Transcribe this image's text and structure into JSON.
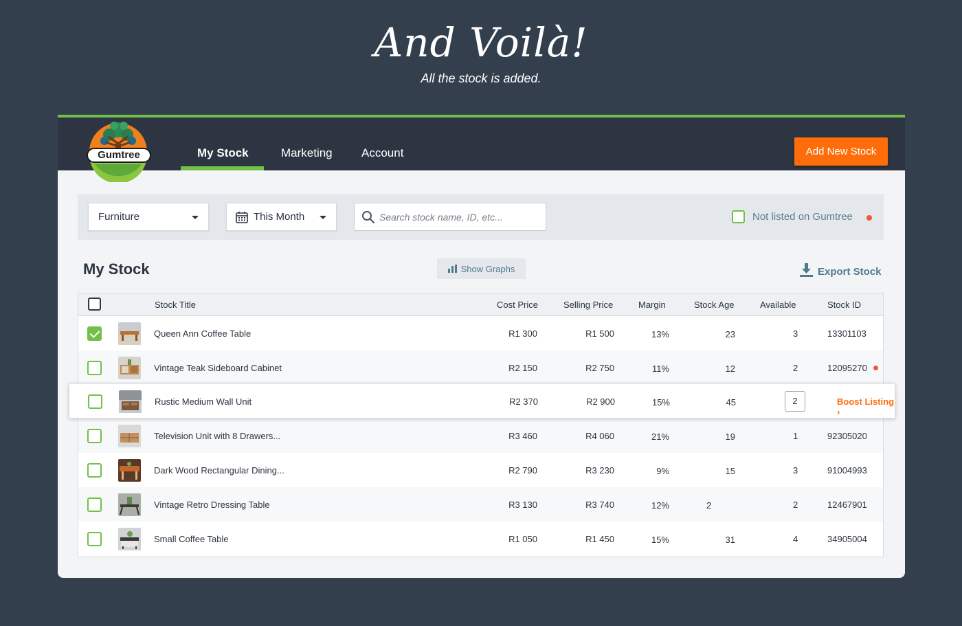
{
  "hero": {
    "title": "And Voilà!",
    "subtitle": "All the stock is added."
  },
  "brand": {
    "logo_text": "Gumtree",
    "accent": "#72c04a",
    "cta_color": "#ff6d0a",
    "header_bg": "#2c3541"
  },
  "nav": {
    "items": [
      "My Stock",
      "Marketing",
      "Account"
    ],
    "active": "My Stock"
  },
  "toolbar": {
    "add_label": "Add New Stock"
  },
  "filters": {
    "category": "Furniture",
    "date_range": "This Month",
    "search_placeholder": "Search stock name, ID, etc...",
    "not_listed_label": "Not listed on Gumtree",
    "not_listed_checked": false
  },
  "section": {
    "title": "My Stock",
    "graphs_label": "Show Graphs",
    "export_label": "Export Stock"
  },
  "table": {
    "columns": [
      "Stock Title",
      "Cost Price",
      "Selling Price",
      "Margin",
      "Stock Age",
      "Available",
      "Stock ID"
    ],
    "rows": [
      {
        "checked": true,
        "title": "Queen Ann Coffee Table",
        "cost": "R1 300",
        "sell": "R1 500",
        "margin": "13%",
        "age": "23",
        "available": "3",
        "id": "13301103",
        "thumb": "wood-table"
      },
      {
        "checked": false,
        "title": "Vintage Teak Sideboard Cabinet",
        "cost": "R2 150",
        "sell": "R2 750",
        "margin": "11%",
        "age": "12",
        "available": "2",
        "id": "12095270",
        "thumb": "sideboard",
        "flag": true
      },
      {
        "checked": false,
        "title": "Rustic Medium Wall Unit",
        "cost": "R2 370",
        "sell": "R2 900",
        "margin": "15%",
        "age": "45",
        "available": "2",
        "action": "Boost Listing",
        "thumb": "wall-unit"
      },
      {
        "checked": false,
        "title": "Television Unit with 8 Drawers...",
        "cost": "R3 460",
        "sell": "R4  060",
        "margin": "21%",
        "age": "19",
        "available": "1",
        "id": "92305020",
        "thumb": "tv-unit"
      },
      {
        "checked": false,
        "title": "Dark Wood Rectangular Dining...",
        "cost": "R2 790",
        "sell": "R3 230",
        "margin": "9%",
        "age": "15",
        "available": "3",
        "id": "91004993",
        "thumb": "dining"
      },
      {
        "checked": false,
        "title": " Vintage Retro Dressing Table",
        "cost": "R3 130",
        "sell": "R3 740",
        "margin": "12%",
        "age": "2",
        "available": "2",
        "id": "12467901",
        "thumb": "dressing"
      },
      {
        "checked": false,
        "title": "Small Coffee Table",
        "cost": "R1 050",
        "sell": "R1 450",
        "margin": "15%",
        "age": "31",
        "available": "4",
        "id": "34905004",
        "thumb": "coffee"
      }
    ]
  }
}
